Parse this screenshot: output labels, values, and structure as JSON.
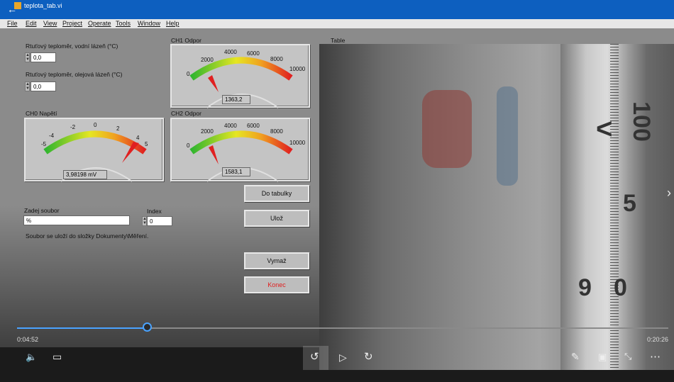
{
  "window": {
    "title": "teplota_tab.vi"
  },
  "menu": [
    "File",
    "Edit",
    "View",
    "Project",
    "Operate",
    "Tools",
    "Window",
    "Help"
  ],
  "controls": {
    "water_label": "Rtuťový teploměr, vodní lázeň (°C)",
    "water_value": "0,0",
    "oil_label": "Rtuťový teploměr, olejová lázeň (°C)",
    "oil_value": "0,0"
  },
  "gauges": {
    "ch0": {
      "label": "CH0 Napětí",
      "value": "3,98198 mV",
      "ticks": [
        "-5",
        "-4",
        "-2",
        "0",
        "2",
        "4",
        "5"
      ],
      "reading": 3.98198,
      "min": -5,
      "max": 5
    },
    "ch1": {
      "label": "CH1 Odpor",
      "value": "1363,2",
      "ticks": [
        "0",
        "2000",
        "4000",
        "6000",
        "8000",
        "10000"
      ],
      "reading": 1363.2,
      "min": 0,
      "max": 10000
    },
    "ch2": {
      "label": "CH2 Odpor",
      "value": "1583,1",
      "ticks": [
        "0",
        "2000",
        "4000",
        "6000",
        "8000",
        "10000"
      ],
      "reading": 1583.1,
      "min": 0,
      "max": 10000
    }
  },
  "file": {
    "label": "Zadej soubor",
    "value": "%",
    "index_label": "Index",
    "index_value": "0",
    "note": "Soubor se uloží do složky Dokumenty\\Měření."
  },
  "buttons": {
    "table": "Do tabulky",
    "save": "Ulož",
    "clear": "Vymaž",
    "end": "Konec"
  },
  "table_label": "Table",
  "player": {
    "current_time": "0:04:52",
    "total_time": "0:20:26",
    "progress": 0.2
  }
}
